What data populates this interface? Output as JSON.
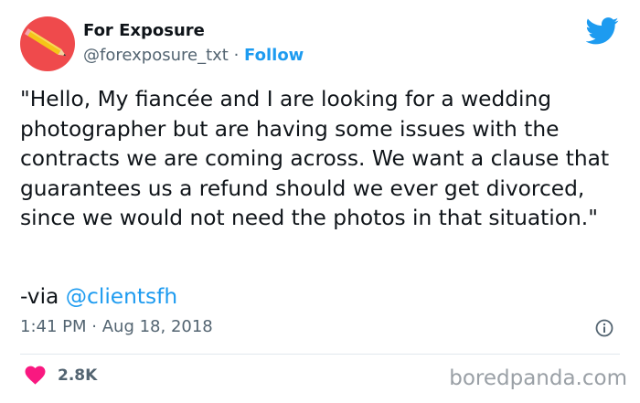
{
  "header": {
    "display_name": "For Exposure",
    "handle": "@forexposure_txt",
    "separator": "·",
    "follow_label": "Follow",
    "avatar_icon": "pencil-icon",
    "platform_icon": "twitter-bird-icon"
  },
  "tweet": {
    "text": "\"Hello, My fiancée and I are looking for a wedding photographer but are having some issues with the contracts we are coming across. We want a clause that guarantees us a refund should we ever get divorced, since we would not need the photos in that situation.\"",
    "via_prefix": "-via",
    "via_mention": "@clientsfh"
  },
  "meta": {
    "time": "1:41 PM",
    "separator": "·",
    "date": "Aug 18, 2018",
    "info_icon": "info-icon"
  },
  "engagement": {
    "like_icon": "heart-icon",
    "like_count": "2.8K"
  },
  "watermark": "boredpanda.com",
  "colors": {
    "accent": "#1d9bf0",
    "heart": "#f91880",
    "avatar_bg": "#ef4a4c",
    "text": "#0f1419",
    "muted": "#536471"
  }
}
